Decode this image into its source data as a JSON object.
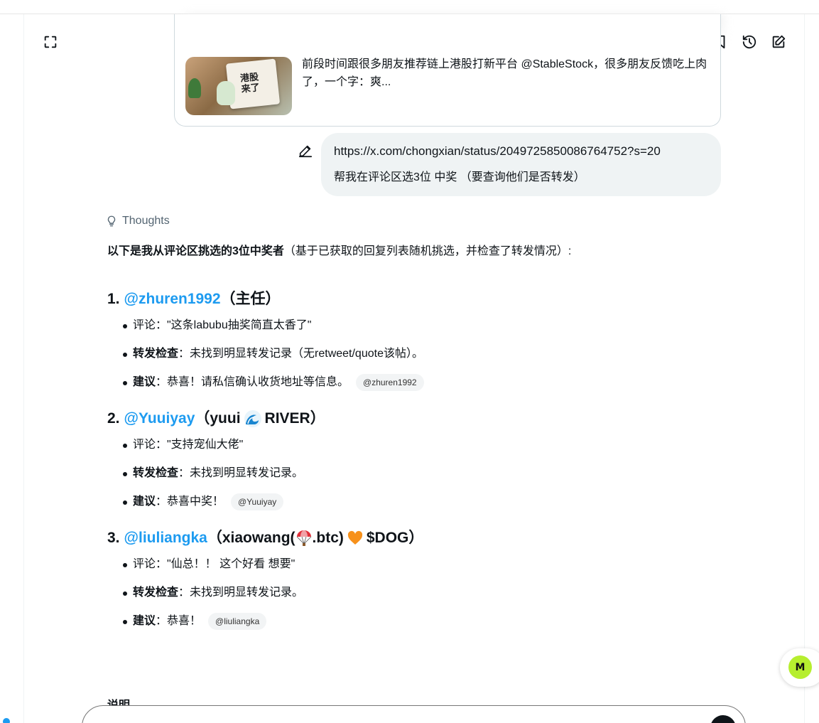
{
  "toolbar": {
    "expand_icon": "expand-icon",
    "share_icon": "share-icon",
    "bookmark_icon": "bookmark-icon",
    "history_icon": "history-icon",
    "new_chat_icon": "compose-icon"
  },
  "linked_post": {
    "thumbnail_text": "港股\n来了",
    "snippet": "前段时间跟很多朋友推荐链上港股打新平台 @StableStock，很多朋友反馈吃上肉了，一个字：爽..."
  },
  "user_message": {
    "url": "https://x.com/chongxian/status/2049725850086764752?s=20",
    "text": "帮我在评论区选3位 中奖 （要查询他们是否转发）"
  },
  "response": {
    "thoughts_label": "Thoughts",
    "intro_bold": "以下是我从评论区挑选的3位中奖者",
    "intro_rest": "（基于已获取的回复列表随机挑选，并检查了转发情况）:",
    "winners": [
      {
        "number": "1.",
        "handle": "@zhuren1992",
        "name": "（主任）",
        "comment": "评论：\"这条labubu抽奖简直太香了\"",
        "repost_label": "转发检查",
        "repost_value": "：未找到明显转发记录（无retweet/quote该帖）。",
        "advice_label": "建议",
        "advice_value": "：恭喜！请私信确认收货地址等信息。",
        "chip": "@zhuren1992"
      },
      {
        "number": "2.",
        "handle": "@Yuuiyay",
        "name_before": "（yuui",
        "name_after": "RIVER）",
        "comment": "评论：\"支持宠仙大佬\"",
        "repost_label": "转发检查",
        "repost_value": "：未找到明显转发记录。",
        "advice_label": "建议",
        "advice_value": "：恭喜中奖！",
        "chip": "@Yuuiyay"
      },
      {
        "number": "3.",
        "handle": "@liuliangka",
        "name_part1": "（xiaowang(",
        "name_part2": ".btc)",
        "name_part3": "$DOG）",
        "comment": "评论：\"仙总！！ 这个好看 想要\"",
        "repost_label": "转发检查",
        "repost_value": "：未找到明显转发记录。",
        "advice_label": "建议",
        "advice_value": "：恭喜！",
        "chip": "@liuliangka"
      }
    ],
    "trailing_heading": "说明"
  },
  "colors": {
    "accent": "#1d9bf0",
    "bubble_bg": "#eff3f4",
    "logo_green": "#b6ee2f"
  }
}
